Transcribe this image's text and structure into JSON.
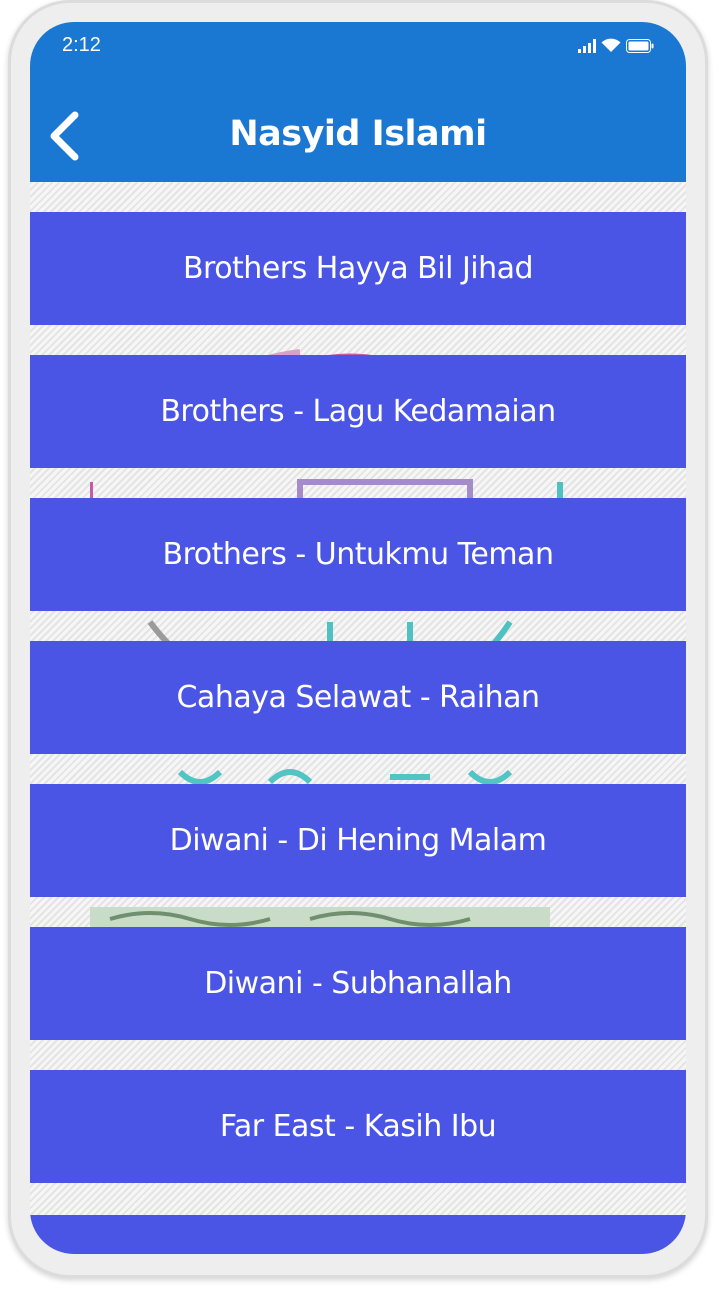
{
  "status_bar": {
    "time": "2:12",
    "icons": [
      "signal-icon",
      "wifi-icon",
      "battery-icon"
    ]
  },
  "app_bar": {
    "title": "Nasyid Islami",
    "back_icon": "chevron-left-icon",
    "color": "#1b78d2"
  },
  "colors": {
    "list_item_bg": "#4a55e6",
    "list_item_text": "#ffffff"
  },
  "songs": [
    {
      "label": "Brothers Hayya Bil Jihad"
    },
    {
      "label": "Brothers - Lagu Kedamaian"
    },
    {
      "label": "Brothers - Untukmu Teman"
    },
    {
      "label": "Cahaya Selawat - Raihan"
    },
    {
      "label": "Diwani - Di Hening Malam"
    },
    {
      "label": "Diwani - Subhanallah"
    },
    {
      "label": "Far East - Kasih Ibu"
    },
    {
      "label": ""
    }
  ]
}
